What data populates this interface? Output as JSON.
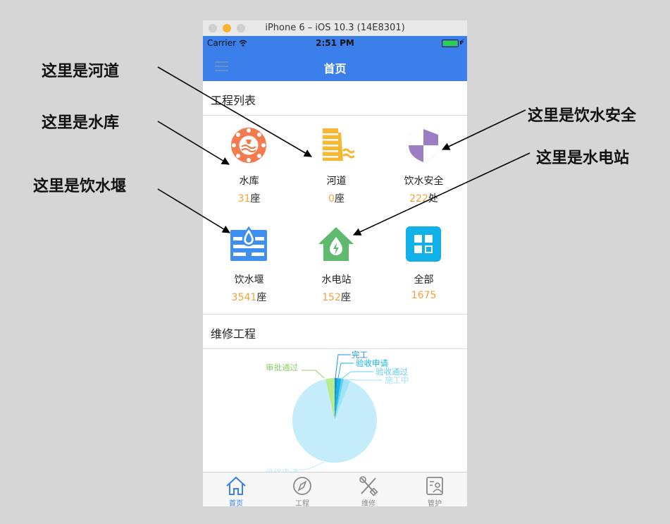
{
  "simulator": {
    "title": "iPhone 6 – iOS 10.3 (14E8301)"
  },
  "status_bar": {
    "carrier": "Carrier",
    "time": "2:51 PM"
  },
  "navbar": {
    "title": "首页"
  },
  "annotations": {
    "river": "这里是河道",
    "reservoir": "这里是水库",
    "weir": "这里是饮水堰",
    "water_safety": "这里是饮水安全",
    "hydropower": "这里是水电站"
  },
  "project_list": {
    "title": "工程列表",
    "items": [
      {
        "name": "水库",
        "count": "31",
        "unit": "座",
        "icon": "reservoir-icon",
        "color": "#f47b4e"
      },
      {
        "name": "河道",
        "count": "0",
        "unit": "座",
        "icon": "river-icon",
        "color": "#f6b833"
      },
      {
        "name": "饮水安全",
        "count": "222",
        "unit": "处",
        "icon": "shield-icon",
        "color": "#9b7fc2"
      },
      {
        "name": "饮水堰",
        "count": "3541",
        "unit": "座",
        "icon": "weir-icon",
        "color": "#3f8ff0"
      },
      {
        "name": "水电站",
        "count": "152",
        "unit": "座",
        "icon": "hydropower-icon",
        "color": "#5fba6d"
      },
      {
        "name": "全部",
        "count": "1675",
        "unit": "",
        "icon": "grid-icon",
        "color": "#12b0e8"
      }
    ]
  },
  "maintenance": {
    "title": "维修工程",
    "chart_data": {
      "type": "pie",
      "slices": [
        {
          "name": "维修申请",
          "value": 90.5,
          "color": "#c5ecfb"
        },
        {
          "name": "审批通过",
          "value": 3.5,
          "color": "#b7ec8e"
        },
        {
          "name": "完工",
          "value": 1.0,
          "color": "#1e8fd6"
        },
        {
          "name": "验收申请",
          "value": 1.5,
          "color": "#19b6e3"
        },
        {
          "name": "验收通过",
          "value": 1.0,
          "color": "#63d0ee"
        },
        {
          "name": "施工中",
          "value": 2.5,
          "color": "#9ee3f6"
        }
      ],
      "label_colors": {
        "审批通过": "#8fd16a",
        "完工": "#1e8fd6",
        "验收申请": "#19b6e3",
        "验收通过": "#63d0ee",
        "施工中": "#9ee3f6",
        "维修申请": "#c5ecfb"
      }
    }
  },
  "tabbar": {
    "items": [
      {
        "label": "首页",
        "icon": "home-icon",
        "active": true
      },
      {
        "label": "工程",
        "icon": "compass-icon",
        "active": false
      },
      {
        "label": "维修",
        "icon": "tools-icon",
        "active": false
      },
      {
        "label": "管护",
        "icon": "profile-card-icon",
        "active": false
      }
    ]
  }
}
